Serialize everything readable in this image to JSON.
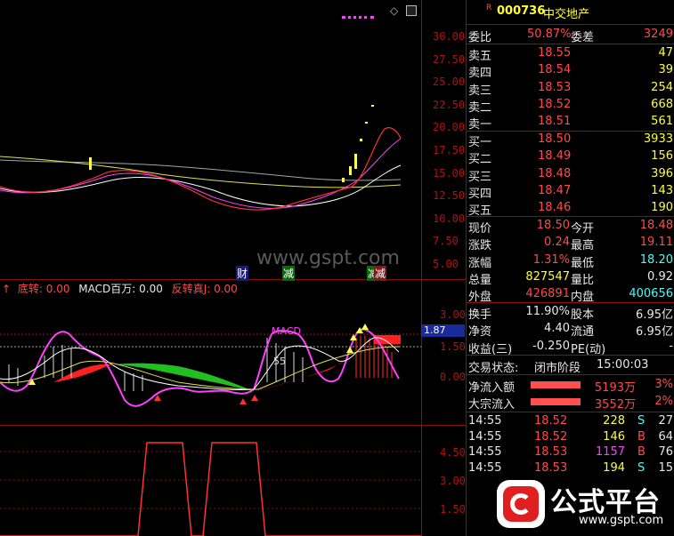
{
  "stock": {
    "marker": "R",
    "code": "000736",
    "name": "中交地产"
  },
  "main_chart": {
    "y_ticks": [
      "30.00",
      "27.50",
      "25.00",
      "22.50",
      "20.00",
      "17.50",
      "15.00",
      "12.50",
      "10.00",
      "7.50",
      "5.00"
    ],
    "event_labels": [
      "财",
      "减",
      "减",
      "减"
    ],
    "watermark": "www.gspt.com",
    "toolbar_icons": [
      "diamond-icon",
      "window-icon"
    ]
  },
  "indicator_header": {
    "arrow": "↑",
    "label1": "底转: 0.00",
    "label2": "MACD百万: 0.00",
    "label3": "反转真J: 0.00"
  },
  "macd_chart": {
    "y_ticks": [
      "3.00",
      "1.50",
      "0.00"
    ],
    "current_value": "1.87",
    "annotation_macd": "MACD",
    "annotation_55": "55"
  },
  "lower_chart": {
    "y_ticks": [
      "4.50",
      "3.00",
      "1.50"
    ]
  },
  "quote": {
    "weibi_label": "委比",
    "weibi_value": "50.87%",
    "weicha_label": "委差",
    "weicha_value": "3249",
    "asks": [
      {
        "label": "卖五",
        "price": "18.55",
        "vol": "47"
      },
      {
        "label": "卖四",
        "price": "18.54",
        "vol": "39"
      },
      {
        "label": "卖三",
        "price": "18.53",
        "vol": "254"
      },
      {
        "label": "卖二",
        "price": "18.52",
        "vol": "668"
      },
      {
        "label": "卖一",
        "price": "18.51",
        "vol": "561"
      }
    ],
    "bids": [
      {
        "label": "买一",
        "price": "18.50",
        "vol": "3933"
      },
      {
        "label": "买二",
        "price": "18.49",
        "vol": "156"
      },
      {
        "label": "买三",
        "price": "18.48",
        "vol": "396"
      },
      {
        "label": "买四",
        "price": "18.47",
        "vol": "143"
      },
      {
        "label": "买五",
        "price": "18.46",
        "vol": "190"
      }
    ],
    "stats": [
      {
        "l1": "现价",
        "v1": "18.50",
        "l2": "今开",
        "v2": "18.48"
      },
      {
        "l1": "涨跌",
        "v1": "0.24",
        "l2": "最高",
        "v2": "19.11"
      },
      {
        "l1": "涨幅",
        "v1": "1.31%",
        "l2": "最低",
        "v2": "18.20"
      },
      {
        "l1": "总量",
        "v1": "827547",
        "l2": "量比",
        "v2": "0.92"
      },
      {
        "l1": "外盘",
        "v1": "426891",
        "l2": "内盘",
        "v2": "400656"
      }
    ],
    "stats2": [
      {
        "l1": "换手",
        "v1": "11.90%",
        "l2": "股本",
        "v2": "6.95亿"
      },
      {
        "l1": "净资",
        "v1": "4.40",
        "l2": "流通",
        "v2": "6.95亿"
      },
      {
        "l1": "收益(三)",
        "v1": "-0.250",
        "l2": "PE(动)",
        "v2": "-"
      }
    ],
    "trade_status_label": "交易状态:",
    "trade_status_value": "闭市阶段",
    "trade_status_time": "15:00:03",
    "flows": [
      {
        "label": "净流入额",
        "amount": "5193万",
        "pct": "3%"
      },
      {
        "label": "大宗流入",
        "amount": "3552万",
        "pct": "2%"
      }
    ],
    "ticks": [
      {
        "time": "14:55",
        "price": "18.52",
        "vol": "228",
        "side": "S",
        "n": "27"
      },
      {
        "time": "14:55",
        "price": "18.52",
        "vol": "146",
        "side": "B",
        "n": "64"
      },
      {
        "time": "14:55",
        "price": "18.53",
        "vol": "1157",
        "side": "B",
        "n": "76"
      },
      {
        "time": "14:55",
        "price": "18.53",
        "vol": "194",
        "side": "S",
        "n": "15"
      }
    ]
  },
  "logo": {
    "text": "公式平台",
    "url": "www.gspt.com"
  }
}
